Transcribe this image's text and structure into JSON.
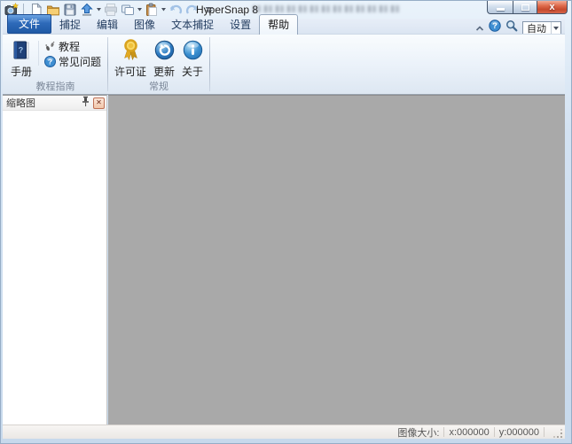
{
  "window": {
    "title": "HyperSnap 8"
  },
  "zoom_control": {
    "value": "自动"
  },
  "tabs": {
    "file": "文件",
    "items": [
      {
        "label": "捕捉"
      },
      {
        "label": "编辑"
      },
      {
        "label": "图像"
      },
      {
        "label": "文本捕捉"
      },
      {
        "label": "设置"
      },
      {
        "label": "帮助"
      }
    ],
    "active": "帮助"
  },
  "ribbon": {
    "groups": [
      {
        "label": "教程指南",
        "buttons": [
          {
            "label": "手册"
          },
          {
            "label": "教程"
          },
          {
            "label": "常见问题"
          }
        ]
      },
      {
        "label": "常规",
        "buttons": [
          {
            "label": "许可证"
          },
          {
            "label": "更新"
          },
          {
            "label": "关于"
          }
        ]
      }
    ]
  },
  "thumbnail_panel": {
    "title": "缩略图"
  },
  "statusbar": {
    "size_label": "图像大小:",
    "x_value": "x:000000",
    "y_value": "y:000000"
  },
  "icons": {
    "app": "camera-star-icon",
    "new": "new-page-icon",
    "open": "open-folder-icon",
    "save": "save-floppy-icon",
    "upload": "capture-upload-arrow-icon",
    "print": "printer-icon",
    "copy": "copy-window-icon",
    "paste": "paste-clipboard-icon",
    "undo": "undo-arrow-icon",
    "redo": "redo-arrow-icon",
    "customize": "customize-toolbar-icon",
    "collapse_ribbon": "chevron-up-icon",
    "help": "question-circle-icon",
    "zoom": "magnifier-icon",
    "manual": "book-icon",
    "tutorial": "footprints-icon",
    "faq": "question-circle-icon",
    "license": "gold-medal-icon",
    "update": "refresh-circle-icon",
    "about": "info-circle-icon",
    "pin": "pin-icon",
    "panel_close": "close-icon",
    "resize_grip": "resize-grip-icon"
  },
  "colors": {
    "file_tab_blue": "#2e6ab9",
    "workspace_gray": "#a9a9a9",
    "close_button_red": "#d6654a",
    "medal_gold": "#e8b62a",
    "icon_blue": "#2e7cc2"
  }
}
